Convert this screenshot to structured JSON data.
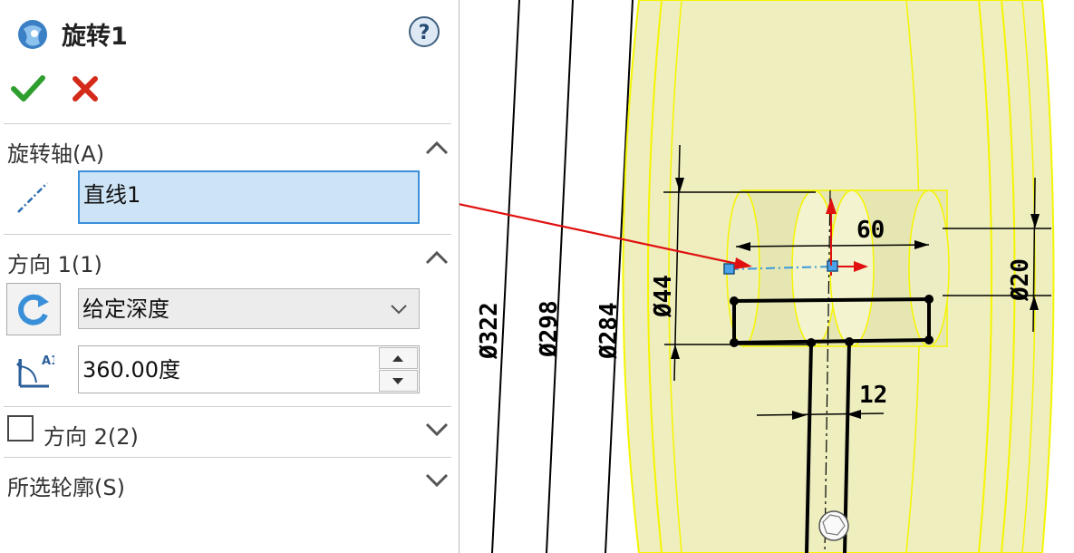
{
  "feature": {
    "title": "旋转1"
  },
  "sections": {
    "axis": {
      "label": "旋转轴(A)",
      "value": "直线1"
    },
    "direction1": {
      "label": "方向 1(1)",
      "end_condition": "给定深度",
      "angle": "360.00度"
    },
    "direction2": {
      "label": "方向 2(2)"
    },
    "contours": {
      "label": "所选轮廓(S)"
    }
  },
  "drawing": {
    "dims": {
      "d322": "Ø322",
      "d298": "Ø298",
      "d284": "Ø284",
      "d44": "Ø44",
      "d20": "Ø20",
      "len60": "60",
      "len12": "12"
    }
  },
  "colors": {
    "ok": "#2e9e2e",
    "cancel": "#d42a1a",
    "selection": "#cde4f7",
    "selection_border": "#3a8fd9",
    "body": "#eeeebd",
    "edge": "#f5f500"
  }
}
